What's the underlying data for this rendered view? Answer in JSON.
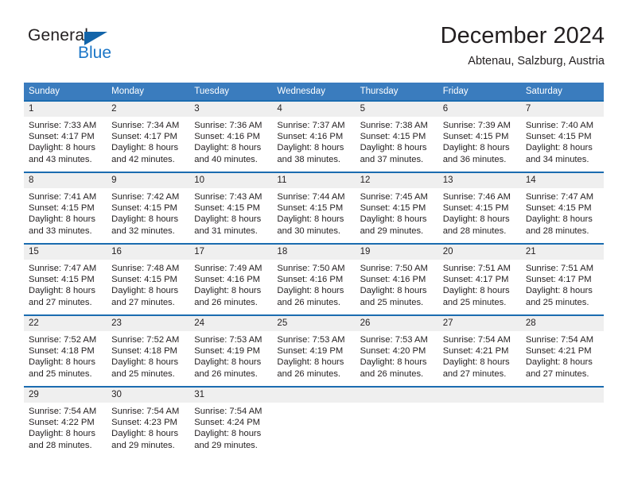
{
  "brand": {
    "name_part1": "General",
    "name_part2": "Blue",
    "triangle_color": "#1264a9",
    "blue_color": "#1b76c7"
  },
  "header": {
    "title": "December 2024",
    "subtitle": "Abtenau, Salzburg, Austria"
  },
  "colors": {
    "header_row": "#3a7cbe",
    "week_separator": "#1b6cb0",
    "daynum_band": "#efefef",
    "text": "#231f20"
  },
  "calendar": {
    "daynames": [
      "Sunday",
      "Monday",
      "Tuesday",
      "Wednesday",
      "Thursday",
      "Friday",
      "Saturday"
    ],
    "weeks": [
      {
        "days": [
          {
            "num": "1",
            "sunrise": "Sunrise: 7:33 AM",
            "sunset": "Sunset: 4:17 PM",
            "daylight1": "Daylight: 8 hours",
            "daylight2": "and 43 minutes."
          },
          {
            "num": "2",
            "sunrise": "Sunrise: 7:34 AM",
            "sunset": "Sunset: 4:17 PM",
            "daylight1": "Daylight: 8 hours",
            "daylight2": "and 42 minutes."
          },
          {
            "num": "3",
            "sunrise": "Sunrise: 7:36 AM",
            "sunset": "Sunset: 4:16 PM",
            "daylight1": "Daylight: 8 hours",
            "daylight2": "and 40 minutes."
          },
          {
            "num": "4",
            "sunrise": "Sunrise: 7:37 AM",
            "sunset": "Sunset: 4:16 PM",
            "daylight1": "Daylight: 8 hours",
            "daylight2": "and 38 minutes."
          },
          {
            "num": "5",
            "sunrise": "Sunrise: 7:38 AM",
            "sunset": "Sunset: 4:15 PM",
            "daylight1": "Daylight: 8 hours",
            "daylight2": "and 37 minutes."
          },
          {
            "num": "6",
            "sunrise": "Sunrise: 7:39 AM",
            "sunset": "Sunset: 4:15 PM",
            "daylight1": "Daylight: 8 hours",
            "daylight2": "and 36 minutes."
          },
          {
            "num": "7",
            "sunrise": "Sunrise: 7:40 AM",
            "sunset": "Sunset: 4:15 PM",
            "daylight1": "Daylight: 8 hours",
            "daylight2": "and 34 minutes."
          }
        ]
      },
      {
        "days": [
          {
            "num": "8",
            "sunrise": "Sunrise: 7:41 AM",
            "sunset": "Sunset: 4:15 PM",
            "daylight1": "Daylight: 8 hours",
            "daylight2": "and 33 minutes."
          },
          {
            "num": "9",
            "sunrise": "Sunrise: 7:42 AM",
            "sunset": "Sunset: 4:15 PM",
            "daylight1": "Daylight: 8 hours",
            "daylight2": "and 32 minutes."
          },
          {
            "num": "10",
            "sunrise": "Sunrise: 7:43 AM",
            "sunset": "Sunset: 4:15 PM",
            "daylight1": "Daylight: 8 hours",
            "daylight2": "and 31 minutes."
          },
          {
            "num": "11",
            "sunrise": "Sunrise: 7:44 AM",
            "sunset": "Sunset: 4:15 PM",
            "daylight1": "Daylight: 8 hours",
            "daylight2": "and 30 minutes."
          },
          {
            "num": "12",
            "sunrise": "Sunrise: 7:45 AM",
            "sunset": "Sunset: 4:15 PM",
            "daylight1": "Daylight: 8 hours",
            "daylight2": "and 29 minutes."
          },
          {
            "num": "13",
            "sunrise": "Sunrise: 7:46 AM",
            "sunset": "Sunset: 4:15 PM",
            "daylight1": "Daylight: 8 hours",
            "daylight2": "and 28 minutes."
          },
          {
            "num": "14",
            "sunrise": "Sunrise: 7:47 AM",
            "sunset": "Sunset: 4:15 PM",
            "daylight1": "Daylight: 8 hours",
            "daylight2": "and 28 minutes."
          }
        ]
      },
      {
        "days": [
          {
            "num": "15",
            "sunrise": "Sunrise: 7:47 AM",
            "sunset": "Sunset: 4:15 PM",
            "daylight1": "Daylight: 8 hours",
            "daylight2": "and 27 minutes."
          },
          {
            "num": "16",
            "sunrise": "Sunrise: 7:48 AM",
            "sunset": "Sunset: 4:15 PM",
            "daylight1": "Daylight: 8 hours",
            "daylight2": "and 27 minutes."
          },
          {
            "num": "17",
            "sunrise": "Sunrise: 7:49 AM",
            "sunset": "Sunset: 4:16 PM",
            "daylight1": "Daylight: 8 hours",
            "daylight2": "and 26 minutes."
          },
          {
            "num": "18",
            "sunrise": "Sunrise: 7:50 AM",
            "sunset": "Sunset: 4:16 PM",
            "daylight1": "Daylight: 8 hours",
            "daylight2": "and 26 minutes."
          },
          {
            "num": "19",
            "sunrise": "Sunrise: 7:50 AM",
            "sunset": "Sunset: 4:16 PM",
            "daylight1": "Daylight: 8 hours",
            "daylight2": "and 25 minutes."
          },
          {
            "num": "20",
            "sunrise": "Sunrise: 7:51 AM",
            "sunset": "Sunset: 4:17 PM",
            "daylight1": "Daylight: 8 hours",
            "daylight2": "and 25 minutes."
          },
          {
            "num": "21",
            "sunrise": "Sunrise: 7:51 AM",
            "sunset": "Sunset: 4:17 PM",
            "daylight1": "Daylight: 8 hours",
            "daylight2": "and 25 minutes."
          }
        ]
      },
      {
        "days": [
          {
            "num": "22",
            "sunrise": "Sunrise: 7:52 AM",
            "sunset": "Sunset: 4:18 PM",
            "daylight1": "Daylight: 8 hours",
            "daylight2": "and 25 minutes."
          },
          {
            "num": "23",
            "sunrise": "Sunrise: 7:52 AM",
            "sunset": "Sunset: 4:18 PM",
            "daylight1": "Daylight: 8 hours",
            "daylight2": "and 25 minutes."
          },
          {
            "num": "24",
            "sunrise": "Sunrise: 7:53 AM",
            "sunset": "Sunset: 4:19 PM",
            "daylight1": "Daylight: 8 hours",
            "daylight2": "and 26 minutes."
          },
          {
            "num": "25",
            "sunrise": "Sunrise: 7:53 AM",
            "sunset": "Sunset: 4:19 PM",
            "daylight1": "Daylight: 8 hours",
            "daylight2": "and 26 minutes."
          },
          {
            "num": "26",
            "sunrise": "Sunrise: 7:53 AM",
            "sunset": "Sunset: 4:20 PM",
            "daylight1": "Daylight: 8 hours",
            "daylight2": "and 26 minutes."
          },
          {
            "num": "27",
            "sunrise": "Sunrise: 7:54 AM",
            "sunset": "Sunset: 4:21 PM",
            "daylight1": "Daylight: 8 hours",
            "daylight2": "and 27 minutes."
          },
          {
            "num": "28",
            "sunrise": "Sunrise: 7:54 AM",
            "sunset": "Sunset: 4:21 PM",
            "daylight1": "Daylight: 8 hours",
            "daylight2": "and 27 minutes."
          }
        ]
      },
      {
        "days": [
          {
            "num": "29",
            "sunrise": "Sunrise: 7:54 AM",
            "sunset": "Sunset: 4:22 PM",
            "daylight1": "Daylight: 8 hours",
            "daylight2": "and 28 minutes."
          },
          {
            "num": "30",
            "sunrise": "Sunrise: 7:54 AM",
            "sunset": "Sunset: 4:23 PM",
            "daylight1": "Daylight: 8 hours",
            "daylight2": "and 29 minutes."
          },
          {
            "num": "31",
            "sunrise": "Sunrise: 7:54 AM",
            "sunset": "Sunset: 4:24 PM",
            "daylight1": "Daylight: 8 hours",
            "daylight2": "and 29 minutes."
          },
          {
            "num": "",
            "sunrise": "",
            "sunset": "",
            "daylight1": "",
            "daylight2": ""
          },
          {
            "num": "",
            "sunrise": "",
            "sunset": "",
            "daylight1": "",
            "daylight2": ""
          },
          {
            "num": "",
            "sunrise": "",
            "sunset": "",
            "daylight1": "",
            "daylight2": ""
          },
          {
            "num": "",
            "sunrise": "",
            "sunset": "",
            "daylight1": "",
            "daylight2": ""
          }
        ]
      }
    ]
  }
}
